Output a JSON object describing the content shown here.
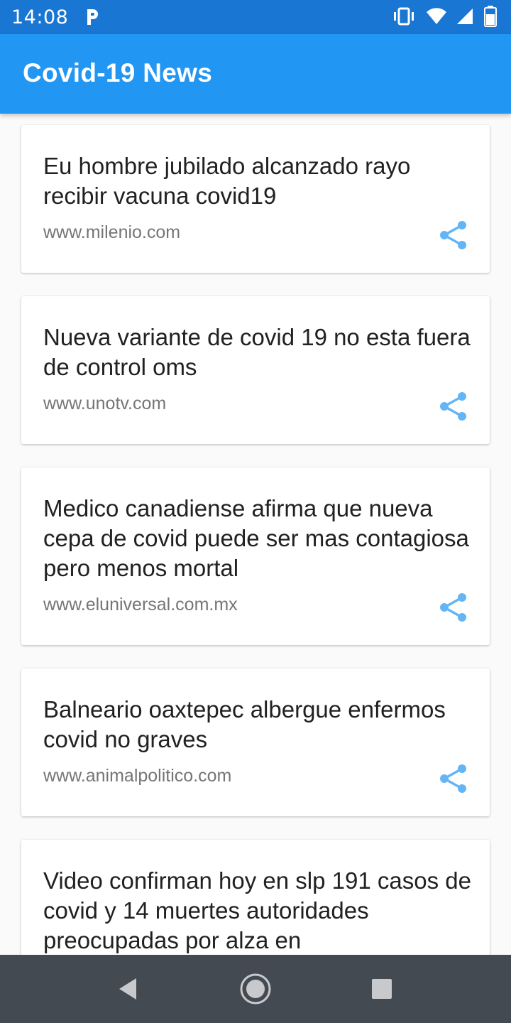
{
  "status_bar": {
    "time": "14:08",
    "left_icon": "parking-icon",
    "right_icons": [
      "vibrate-icon",
      "wifi-icon",
      "signal-icon",
      "battery-icon"
    ]
  },
  "app_bar": {
    "title": "Covid-19 News",
    "color": "#2196f3"
  },
  "news": [
    {
      "title": "Eu hombre jubilado alcanzado rayo recibir vacuna covid19",
      "source": "www.milenio.com",
      "icon": "share-icon"
    },
    {
      "title": "Nueva variante de covid 19 no esta fuera de control oms",
      "source": "www.unotv.com",
      "icon": "share-icon"
    },
    {
      "title": "Medico canadiense afirma que nueva cepa de covid puede ser mas contagiosa pero menos mortal",
      "source": "www.eluniversal.com.mx",
      "icon": "share-icon"
    },
    {
      "title": "Balneario oaxtepec albergue enfermos covid no graves",
      "source": "www.animalpolitico.com",
      "icon": "share-icon"
    },
    {
      "title": "Video  confirman hoy en slp 191 casos de covid y 14 muertes autoridades preocupadas por alza en",
      "source": "",
      "icon": "share-icon"
    }
  ],
  "accent_color": "#64b5f6",
  "nav_bar": {
    "buttons": [
      "back-icon",
      "home-icon",
      "recents-icon"
    ]
  }
}
